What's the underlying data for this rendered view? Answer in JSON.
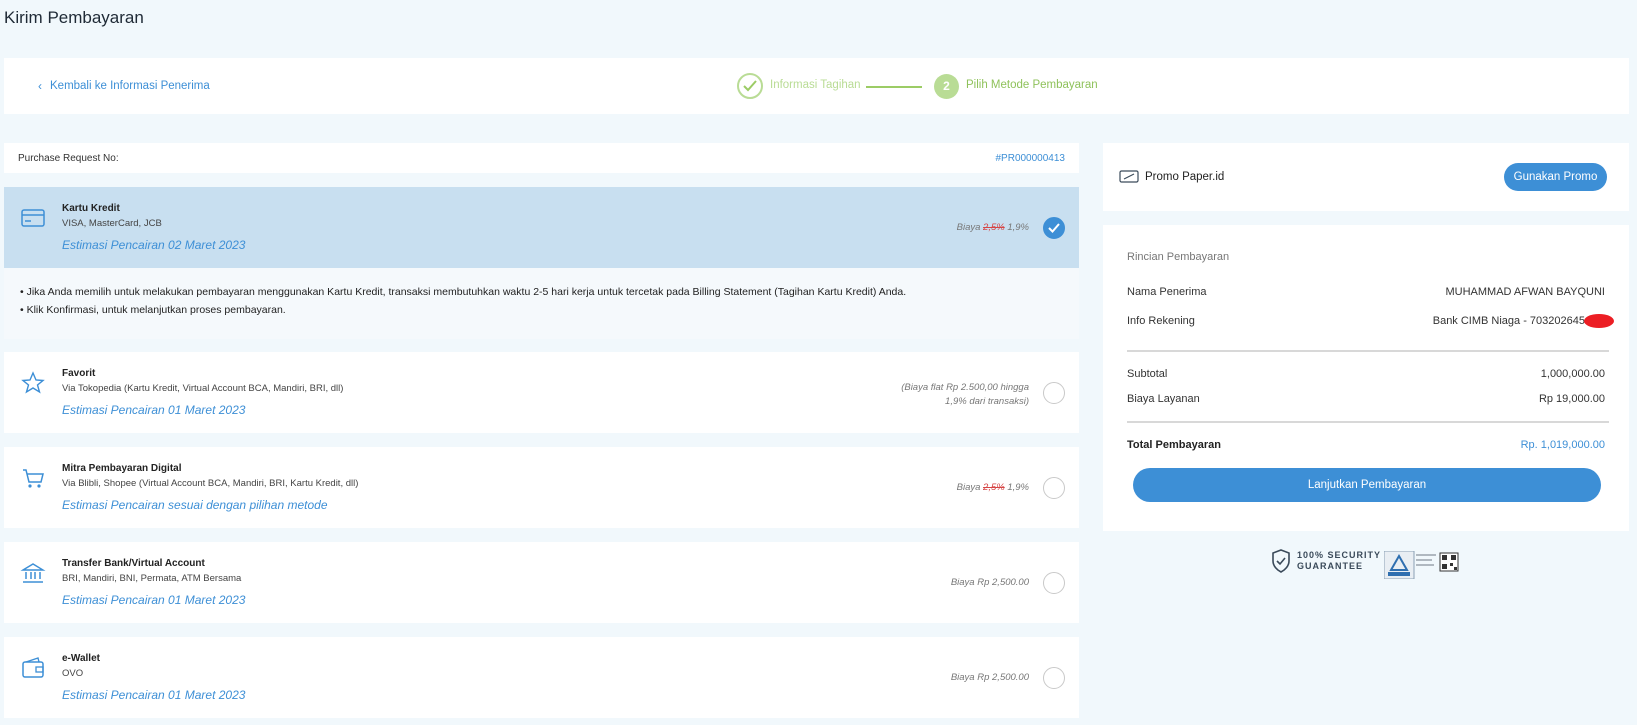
{
  "page": {
    "title": "Kirim Pembayaran"
  },
  "stepper": {
    "back_label": "Kembali ke Informasi Penerima",
    "step1_label": "Informasi Tagihan",
    "step2_number": "2",
    "step2_label": "Pilih Metode Pembayaran"
  },
  "purchase_request": {
    "label": "Purchase Request No:",
    "value": "#PR000000413"
  },
  "methods": [
    {
      "title": "Kartu Kredit",
      "sub": "VISA, MasterCard, JCB",
      "est": "Estimasi Pencairan 02 Maret 2023",
      "fee_prefix": "Biaya",
      "fee_strike": "2,5%",
      "fee_value": "1,9%",
      "selected": true,
      "icon": "credit-card-icon"
    },
    {
      "title": "Favorit",
      "sub": "Via Tokopedia (Kartu Kredit, Virtual Account BCA, Mandiri, BRI, dll)",
      "est": "Estimasi Pencairan 01 Maret 2023",
      "fee_line1": "(Biaya flat Rp 2.500,00 hingga",
      "fee_line2": "1,9% dari transaksi)",
      "selected": false,
      "icon": "star-icon"
    },
    {
      "title": "Mitra Pembayaran Digital",
      "sub": "Via Blibli, Shopee (Virtual Account BCA, Mandiri, BRI, Kartu Kredit, dll)",
      "est": "Estimasi Pencairan sesuai dengan pilihan metode",
      "fee_prefix": "Biaya",
      "fee_strike": "2,5%",
      "fee_value": "1,9%",
      "selected": false,
      "icon": "cart-icon"
    },
    {
      "title": "Transfer Bank/Virtual Account",
      "sub": "BRI, Mandiri, BNI, Permata, ATM Bersama",
      "est": "Estimasi Pencairan 01 Maret 2023",
      "fee_text": "Biaya Rp 2,500.00",
      "selected": false,
      "icon": "bank-icon"
    },
    {
      "title": "e-Wallet",
      "sub": "OVO",
      "est": "Estimasi Pencairan 01 Maret 2023",
      "fee_text": "Biaya Rp 2,500.00",
      "selected": false,
      "icon": "wallet-icon"
    }
  ],
  "credit_notes": [
    "Jika Anda memilih untuk melakukan pembayaran menggunakan Kartu Kredit, transaksi membutuhkan waktu 2-5 hari kerja untuk tercetak pada Billing Statement (Tagihan Kartu Kredit) Anda.",
    "Klik Konfirmasi, untuk melanjutkan proses pembayaran."
  ],
  "promo": {
    "label": "Promo Paper.id",
    "button": "Gunakan Promo"
  },
  "summary": {
    "title": "Rincian Pembayaran",
    "recipient_label": "Nama Penerima",
    "recipient_value": "MUHAMMAD AFWAN BAYQUNI",
    "account_label": "Info Rekening",
    "account_value": "Bank CIMB Niaga - 703202645",
    "subtotal_label": "Subtotal",
    "subtotal_value": "1,000,000.00",
    "fee_label": "Biaya Layanan",
    "fee_value": "Rp 19,000.00",
    "total_label": "Total Pembayaran",
    "total_value": "Rp. 1,019,000.00",
    "cta": "Lanjutkan Pembayaran"
  },
  "security": {
    "line1": "100% SECURITY",
    "line2": "GUARANTEE"
  },
  "colors": {
    "accent": "#3d8fd6",
    "selected_bg": "#c8dff0",
    "step_green": "#9ccc65",
    "page_bg": "#f1f8fc"
  }
}
